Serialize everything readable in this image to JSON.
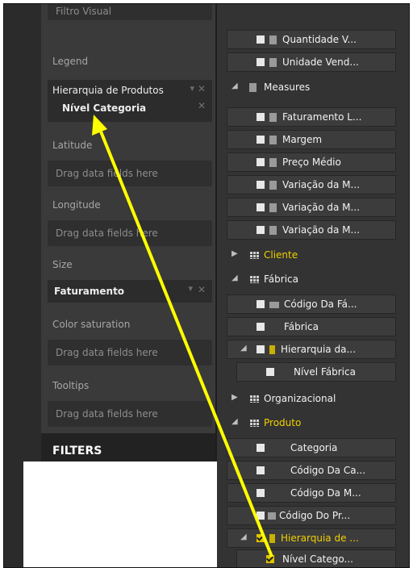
{
  "left_panel": {
    "top_clipped_text": "Filtro Visual",
    "legend": {
      "label": "Legend",
      "field1": "Hierarquia de Produtos",
      "field2": "Nível Categoria"
    },
    "latitude": {
      "label": "Latitude",
      "placeholder": "Drag data fields here"
    },
    "longitude": {
      "label": "Longitude",
      "placeholder": "Drag data fields here"
    },
    "size": {
      "label": "Size",
      "field": "Faturamento"
    },
    "color_saturation": {
      "label": "Color saturation",
      "placeholder": "Drag data fields here"
    },
    "tooltips": {
      "label": "Tooltips",
      "placeholder": "Drag data fields here"
    },
    "filters_title": "FILTERS"
  },
  "fields_list": {
    "items": [
      {
        "text": "Quantidade V...",
        "checked": false
      },
      {
        "text": "Unidade Vend...",
        "checked": false
      },
      {
        "text": "Measures",
        "group": true
      },
      {
        "text": "Faturamento L...",
        "checked": false
      },
      {
        "text": "Margem",
        "checked": false
      },
      {
        "text": "Preço Médio",
        "checked": false
      },
      {
        "text": "Variação da M...",
        "checked": false
      },
      {
        "text": "Variação da M...",
        "checked": false
      },
      {
        "text": "Variação da M...",
        "checked": false
      },
      {
        "text": "Cliente",
        "group": true,
        "highlight": true
      },
      {
        "text": "Fábrica",
        "group": true
      },
      {
        "text": "Código Da Fá...",
        "checked": false
      },
      {
        "text": "Fábrica",
        "checked": false
      },
      {
        "text": "Hierarquia da...",
        "checked": false
      },
      {
        "text": "Nível Fábrica",
        "checked": false
      },
      {
        "text": "Organizacional",
        "group": true
      },
      {
        "text": "Produto",
        "group": true,
        "highlight": true
      },
      {
        "text": "Categoria",
        "checked": false
      },
      {
        "text": "Código Da Ca...",
        "checked": false
      },
      {
        "text": "Código Da M...",
        "checked": false
      },
      {
        "text": "Código Do Pr...",
        "checked": false
      },
      {
        "text": "Hierarquia de ...",
        "checked": true,
        "highlight": true
      },
      {
        "text": "Nível Catego...",
        "checked": true
      }
    ]
  },
  "colors": {
    "accent_yellow": "#f0d000",
    "arrow": "#ffff00"
  }
}
